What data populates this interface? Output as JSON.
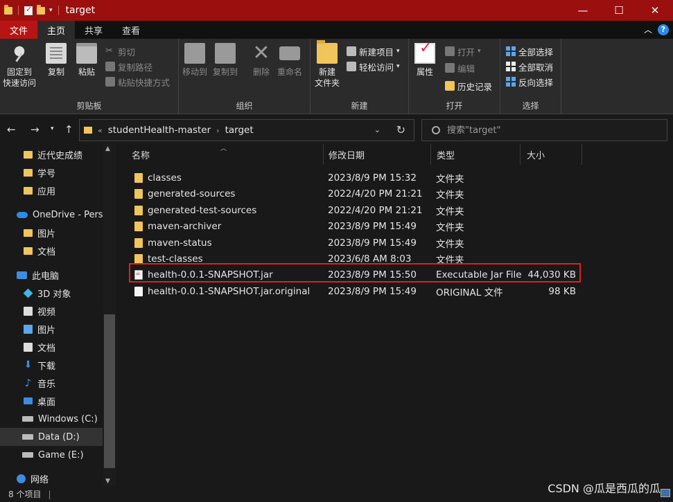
{
  "window": {
    "title": "target",
    "minimize": "—",
    "maximize": "☐",
    "close": "✕"
  },
  "ribbon_tabs": [
    {
      "label": "文件"
    },
    {
      "label": "主页"
    },
    {
      "label": "共享"
    },
    {
      "label": "查看"
    }
  ],
  "ribbon": {
    "clipboard": {
      "label": "剪贴板",
      "pin": "固定到\n快速访问",
      "pin_line1": "固定到",
      "pin_line2": "快速访问",
      "copy": "复制",
      "paste": "粘贴",
      "cut": "剪切",
      "copy_path": "复制路径",
      "paste_shortcut": "粘贴快捷方式"
    },
    "organize": {
      "label": "组织",
      "move_to": "移动到",
      "copy_to": "复制到",
      "delete": "删除",
      "rename": "重命名"
    },
    "new": {
      "label": "新建",
      "new_folder_line1": "新建",
      "new_folder_line2": "文件夹",
      "new_item": "新建项目",
      "easy_access": "轻松访问"
    },
    "open": {
      "label": "打开",
      "properties": "属性",
      "open": "打开",
      "edit": "编辑",
      "history": "历史记录"
    },
    "select": {
      "label": "选择",
      "select_all": "全部选择",
      "select_none": "全部取消",
      "invert": "反向选择"
    }
  },
  "address": {
    "prefix": "«",
    "crumbs": [
      "studentHealth-master",
      "target"
    ],
    "separator": "›"
  },
  "search": {
    "placeholder": "搜索\"target\""
  },
  "nav_pane": [
    {
      "label": "近代史成绩",
      "icon": "folder-icon"
    },
    {
      "label": "学号",
      "icon": "folder-icon"
    },
    {
      "label": "应用",
      "icon": "folder-icon"
    },
    {
      "label": "OneDrive - Persc",
      "icon": "onedrive-icon"
    },
    {
      "label": "图片",
      "icon": "folder-icon"
    },
    {
      "label": "文档",
      "icon": "folder-icon"
    },
    {
      "label": "此电脑",
      "icon": "pc-icon"
    },
    {
      "label": "3D 对象",
      "icon": "3d-objects-icon"
    },
    {
      "label": "视频",
      "icon": "video-icon"
    },
    {
      "label": "图片",
      "icon": "pictures-icon"
    },
    {
      "label": "文档",
      "icon": "documents-icon"
    },
    {
      "label": "下载",
      "icon": "download-icon"
    },
    {
      "label": "音乐",
      "icon": "music-icon"
    },
    {
      "label": "桌面",
      "icon": "desktop-icon"
    },
    {
      "label": "Windows (C:)",
      "icon": "drive-icon"
    },
    {
      "label": "Data (D:)",
      "icon": "drive-icon"
    },
    {
      "label": "Game (E:)",
      "icon": "drive-icon"
    },
    {
      "label": "网络",
      "icon": "network-icon"
    }
  ],
  "columns": {
    "name": "名称",
    "date": "修改日期",
    "type": "类型",
    "size": "大小"
  },
  "files": [
    {
      "name": "classes",
      "date": "2023/8/9 PM 15:32",
      "type": "文件夹",
      "size": "",
      "icon": "folder-icon"
    },
    {
      "name": "generated-sources",
      "date": "2022/4/20 PM 21:21",
      "type": "文件夹",
      "size": "",
      "icon": "folder-icon"
    },
    {
      "name": "generated-test-sources",
      "date": "2022/4/20 PM 21:21",
      "type": "文件夹",
      "size": "",
      "icon": "folder-icon"
    },
    {
      "name": "maven-archiver",
      "date": "2023/8/9 PM 15:49",
      "type": "文件夹",
      "size": "",
      "icon": "folder-icon"
    },
    {
      "name": "maven-status",
      "date": "2023/8/9 PM 15:49",
      "type": "文件夹",
      "size": "",
      "icon": "folder-icon"
    },
    {
      "name": "test-classes",
      "date": "2023/6/8 AM 8:03",
      "type": "文件夹",
      "size": "",
      "icon": "folder-icon"
    },
    {
      "name": "health-0.0.1-SNAPSHOT.jar",
      "date": "2023/8/9 PM 15:50",
      "type": "Executable Jar File",
      "size": "44,030 KB",
      "icon": "jar-file-icon"
    },
    {
      "name": "health-0.0.1-SNAPSHOT.jar.original",
      "date": "2023/8/9 PM 15:49",
      "type": "ORIGINAL 文件",
      "size": "98 KB",
      "icon": "file-icon"
    }
  ],
  "status": {
    "count": "8 个项目",
    "separator": "|"
  },
  "watermark": "CSDN @瓜是西瓜的瓜",
  "colors": {
    "titlebar": "#9b0f0f",
    "file_tab": "#b81414",
    "highlight_border": "#e02020",
    "folder": "#f0c55b"
  }
}
